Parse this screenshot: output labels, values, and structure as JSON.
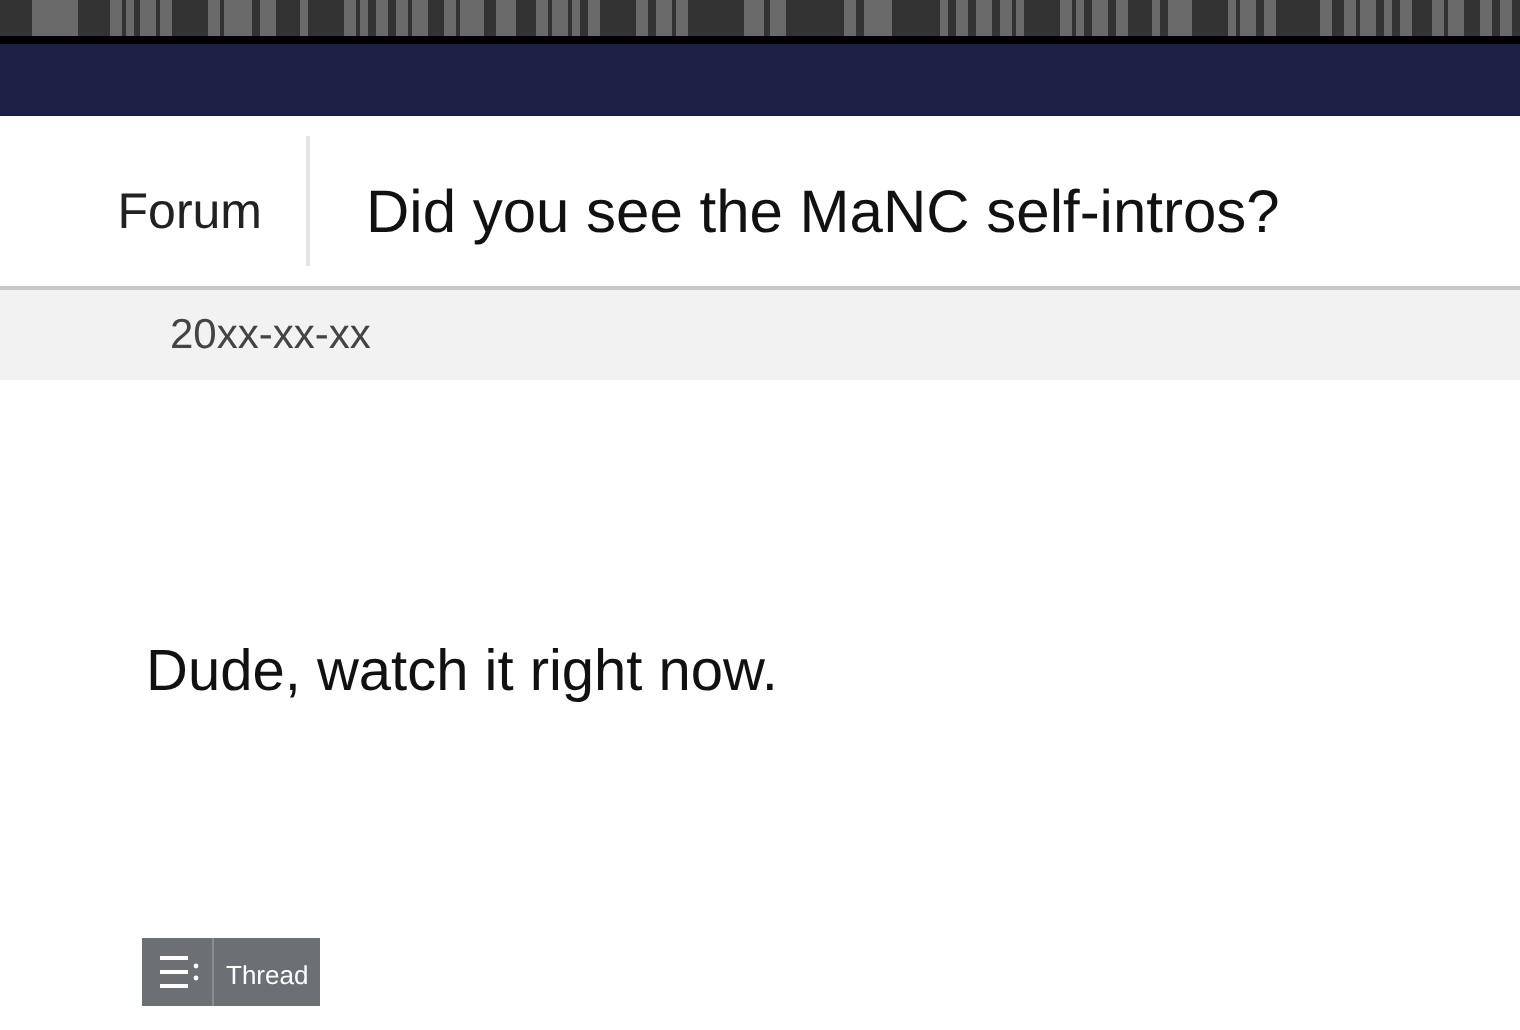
{
  "header": {
    "section": "Forum",
    "title": "Did you see the MaNC self-intros?"
  },
  "date": "20xx-xx-xx",
  "message": "Dude, watch it right now.",
  "thread_button": {
    "label": "Thread"
  }
}
